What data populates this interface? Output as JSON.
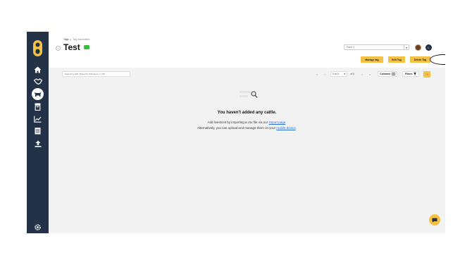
{
  "breadcrumb": {
    "items": [
      "Tags",
      "Tag Information"
    ]
  },
  "page": {
    "title": "Test",
    "tag_color": "#3bbf3b"
  },
  "header": {
    "farm_select": "Farm 2",
    "user_initial": "L"
  },
  "actions": {
    "manage_tag": "Manage tag",
    "edit_tag": "Edit Tag",
    "delete_tag": "Delete Tag"
  },
  "toolbar": {
    "search_placeholder": "Search by EID, Panel ID, Nickname or VID",
    "page_range": "0 to 0",
    "page_of": "of 0",
    "columns_label": "Columns",
    "filters_label": "Filters"
  },
  "empty": {
    "title": "You haven't added any cattle.",
    "line1_prefix": "Add livestock by importing a csv file via our ",
    "import_link": "import page",
    "line1_suffix": ".",
    "line2_prefix": "Alternatively, you can upload and manage them on your ",
    "mobile_link": "mobile device",
    "line2_suffix": "."
  },
  "sidebar": {
    "items": [
      "home-icon",
      "handshake-icon",
      "cattle-icon",
      "archive-icon",
      "chart-icon",
      "calendar-icon",
      "upload-icon"
    ],
    "active": "cattle-icon",
    "bottom": "gear-icon"
  },
  "colors": {
    "accent": "#f4c142",
    "sidebar": "#233247",
    "link": "#2a6ed8"
  }
}
